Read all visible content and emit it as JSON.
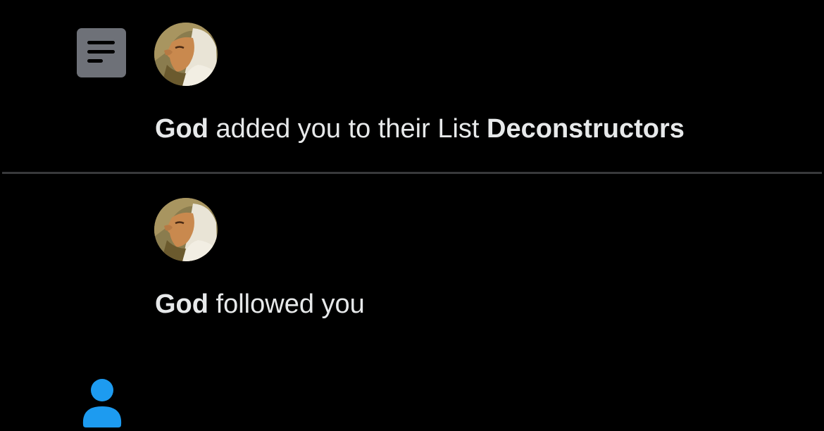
{
  "colors": {
    "background": "#000000",
    "text": "#e7e9ea",
    "divider": "#38393b",
    "list_icon_bg": "#6e7178",
    "follow_icon": "#1d9bf0"
  },
  "notifications": [
    {
      "type_icon": "list-icon",
      "avatar_alt": "God",
      "actor": "God",
      "action": " added you to their List ",
      "target": "Deconstructors"
    },
    {
      "type_icon": "person-icon",
      "avatar_alt": "God",
      "actor": "God",
      "action": " followed you",
      "target": ""
    }
  ]
}
